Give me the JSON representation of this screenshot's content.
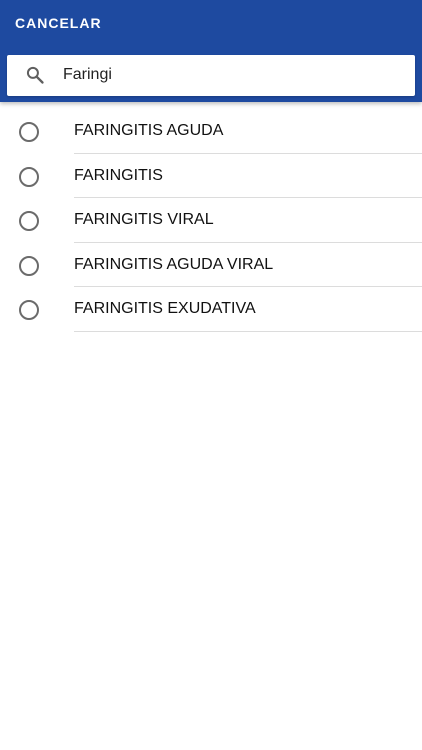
{
  "header": {
    "cancel_label": "CANCELAR",
    "background_color": "#1e4aa0"
  },
  "search": {
    "icon": "search-icon",
    "value": "Faringi"
  },
  "results": [
    {
      "label": "FARINGITIS AGUDA",
      "selected": false
    },
    {
      "label": "FARINGITIS",
      "selected": false
    },
    {
      "label": "FARINGITIS VIRAL",
      "selected": false
    },
    {
      "label": "FARINGITIS AGUDA VIRAL",
      "selected": false
    },
    {
      "label": "FARINGITIS EXUDATIVA",
      "selected": false
    }
  ]
}
